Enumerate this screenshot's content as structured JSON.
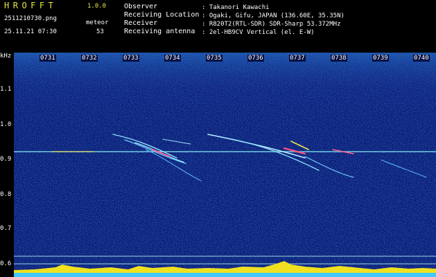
{
  "app": {
    "name": "HROFFT",
    "version": "1.0.0"
  },
  "file": {
    "name": "2511210730.png",
    "timestamp": "25.11.21 07:30"
  },
  "meteor": {
    "label": "meteor",
    "count": "53"
  },
  "info": [
    {
      "key": "Observer",
      "value": ": Takanori Kawachi"
    },
    {
      "key": "Receiving Location",
      "value": ": Ogaki, Gifu, JAPAN (136.60E, 35.35N)"
    },
    {
      "key": "Receiver",
      "value": ": R820T2(RTL-SDR) SDR-Sharp 53.372MHz"
    },
    {
      "key": "Receiving antenna",
      "value": ": 2el-HB9CV Vertical (el. E-W)"
    }
  ],
  "y_axis": {
    "unit": "kHz",
    "ticks": [
      "1.1",
      "1.0",
      "0.9",
      "0.8",
      "0.7",
      "0.6"
    ]
  },
  "x_axis": {
    "ticks": [
      "0731",
      "0732",
      "0733",
      "0734",
      "0735",
      "0736",
      "0737",
      "0738",
      "0739",
      "0740"
    ]
  },
  "colors": {
    "header_title": "#e6e64a",
    "text": "#ffffff",
    "background": "#000000",
    "spectrogram_base": "#0a1a6a"
  }
}
